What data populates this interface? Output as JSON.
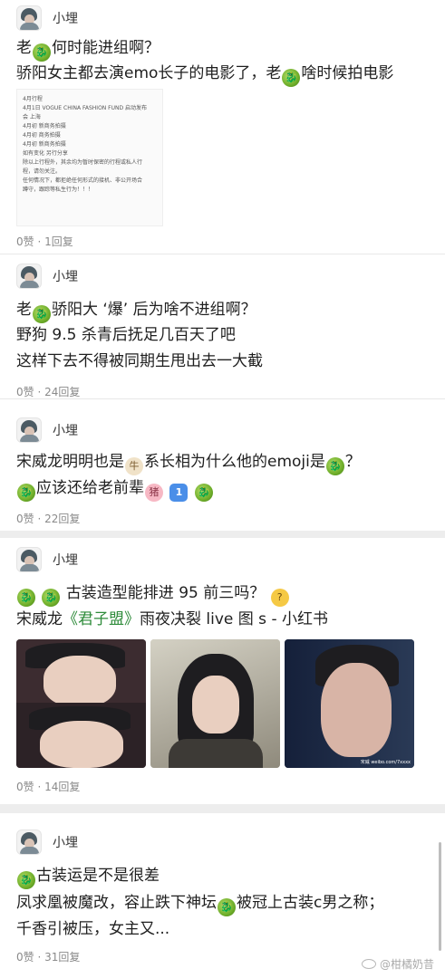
{
  "posts": [
    {
      "user": "小埋",
      "lines": [
        [
          "老",
          "🐉",
          "何时能进组啊？"
        ],
        [
          "骄阳女主都去演emo长子的电影了，老",
          "🐉",
          "啥时候拍电影"
        ]
      ],
      "doc": [
        "4月行程",
        "",
        "4月1日 VOGUE CHINA FASHION FUND 启动发布",
        "会 上海",
        "",
        "4月初 新商务拍摄",
        "4月初 商务拍摄",
        "4月初 新商务拍摄",
        "",
        "如有变化 另行分享",
        "",
        "除以上行程外，其余均为暂时保密的行程或私人行",
        "程，请勿关注。",
        "任何情况下，都拒绝任何形式的接机、非公开场合",
        "蹲守，跟踪等私生行为！！！"
      ],
      "meta": "0赞 · 1回复"
    },
    {
      "user": "小埋",
      "line1_pre": "老",
      "line1_post": "骄阳大 ‘爆’ 后为啥不进组啊？",
      "line2": "野狗 9.5 杀青后抚足几百天了吧",
      "line3": "这样下去不得被同期生甩出去一大截",
      "meta": "0赞 · 24回复"
    },
    {
      "user": "小埋",
      "line1_a": "宋威龙明明也是",
      "line1_b": "系长相为什么他的emoji是",
      "line1_c": "？",
      "line2_a": "应该还给老前辈",
      "meta": "0赞 · 22回复"
    },
    {
      "user": "小埋",
      "line1": "古装造型能排进 95 前三吗？",
      "line2_a": "宋威龙",
      "line2_b": "《君子盟》",
      "line2_c": "雨夜决裂 live 图 s - 小红书",
      "meta": "0赞 · 14回复",
      "photo_caption": "宋威 weibo.com/7xxxx"
    },
    {
      "user": "小埋",
      "line1": "古装运是不是很差",
      "line2_a": "凤求凰被魔改，容止跌下神坛",
      "line2_b": "被冠上古装c男之称；",
      "line3": "千香引被压，女主又...",
      "meta": "0赞 · 31回复"
    }
  ],
  "watermark": "@柑橘奶昔",
  "icons": {
    "dragon": "dragon-emoji",
    "ox": "ox-emoji",
    "pig": "pig-emoji",
    "one": "keycap-one-emoji",
    "think": "thinking-emoji"
  },
  "colors": {
    "background": "#ffffff",
    "divider": "#ededed",
    "meta": "#8a8a8a",
    "title_green": "#2e8b3a"
  }
}
